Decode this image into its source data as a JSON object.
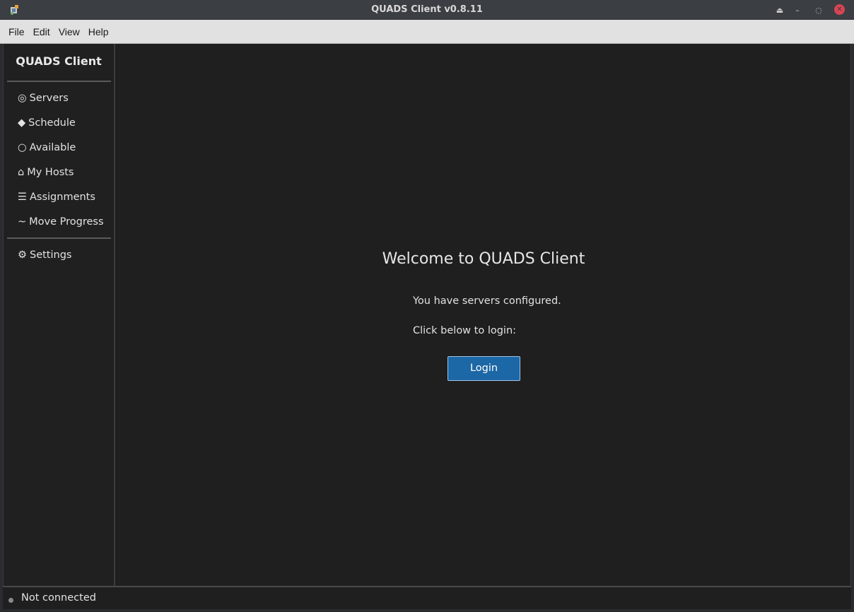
{
  "window": {
    "title": "QUADS Client v0.8.11"
  },
  "menubar": {
    "items": [
      "File",
      "Edit",
      "View",
      "Help"
    ]
  },
  "sidebar": {
    "title": "QUADS Client",
    "items": [
      {
        "glyph": "◎",
        "label": "Servers",
        "icon": "servers-icon"
      },
      {
        "glyph": "◆",
        "label": "Schedule",
        "icon": "schedule-icon"
      },
      {
        "glyph": "○",
        "label": "Available",
        "icon": "available-icon"
      },
      {
        "glyph": "⌂",
        "label": "My Hosts",
        "icon": "home-icon"
      },
      {
        "glyph": "☰",
        "label": "Assignments",
        "icon": "list-icon"
      },
      {
        "glyph": "~",
        "label": "Move Progress",
        "icon": "progress-icon"
      }
    ],
    "settings": {
      "glyph": "⚙",
      "label": "Settings",
      "icon": "gear-icon"
    }
  },
  "main": {
    "heading": "Welcome to QUADS Client",
    "line1": "You have servers configured.",
    "line2": "Click below to login:",
    "login_label": "Login"
  },
  "status": {
    "text": "Not connected"
  },
  "colors": {
    "accent": "#1c67a5",
    "close": "#da4453",
    "background": "#1f1f1f"
  }
}
